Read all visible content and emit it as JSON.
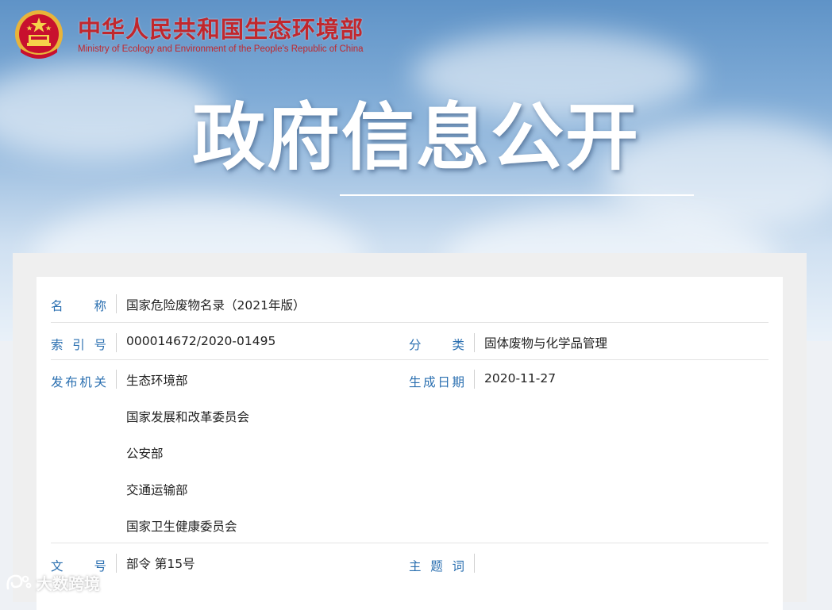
{
  "header": {
    "site_name_cn": "中华人民共和国生态环境部",
    "site_name_en": "Ministry of Ecology and Environment of the People's Republic of China",
    "emblem_icon": "national-emblem-icon",
    "banner_title": "政府信息公开"
  },
  "document": {
    "name_label": "名　　称",
    "name_value": "国家危险废物名录（2021年版）",
    "index_label": "索 引 号",
    "index_value": "000014672/2020-01495",
    "category_label": "分　　类",
    "category_value": "固体废物与化学品管理",
    "issuer_label": "发布机关",
    "issuers": [
      "生态环境部",
      "国家发展和改革委员会",
      "公安部",
      "交通运输部",
      "国家卫生健康委员会"
    ],
    "date_label": "生成日期",
    "date_value": "2020-11-27",
    "docno_label": "文　　号",
    "docno_value": "部令 第15号",
    "keywords_label": "主 题 词",
    "keywords_value": ""
  },
  "watermark": {
    "text": "大数跨境",
    "icon": "brand-logo-icon"
  },
  "colors": {
    "brand_red": "#c1272d",
    "label_blue": "#2a6fb0",
    "text_dark": "#222222"
  }
}
